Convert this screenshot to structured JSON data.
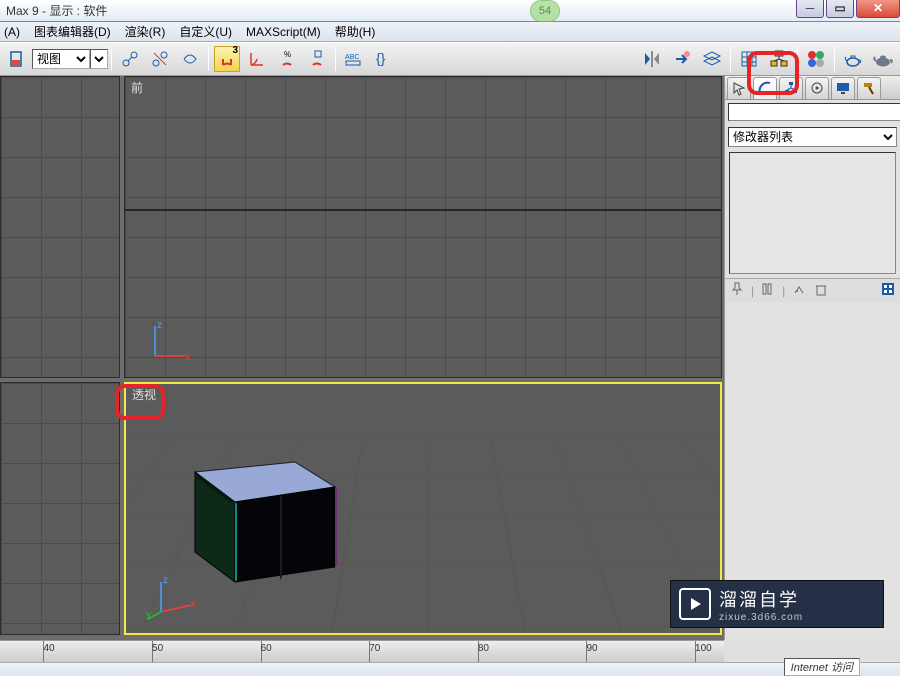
{
  "window": {
    "title": "Max 9      - 显示 : 软件"
  },
  "tab_bubble": "54",
  "menu": {
    "a": "(A)",
    "graph_editor": "图表编辑器(D)",
    "render": "渲染(R)",
    "custom": "自定义(U)",
    "maxscript": "MAXScript(M)",
    "help": "帮助(H)"
  },
  "toolbar": {
    "view_label": "视图",
    "three_badge": "3"
  },
  "viewports": {
    "front": "前",
    "persp": "透视"
  },
  "axes": {
    "x": "x",
    "y": "y",
    "z": "z"
  },
  "right_panel": {
    "name_value": "",
    "modifier_list": "修改器列表"
  },
  "ruler": {
    "ticks": [
      "40",
      "50",
      "60",
      "70",
      "80",
      "90",
      "100"
    ]
  },
  "status": {
    "internet": "Internet 访问"
  },
  "watermark": {
    "brand": "溜溜自学",
    "url": "zixue.3d66.com"
  }
}
